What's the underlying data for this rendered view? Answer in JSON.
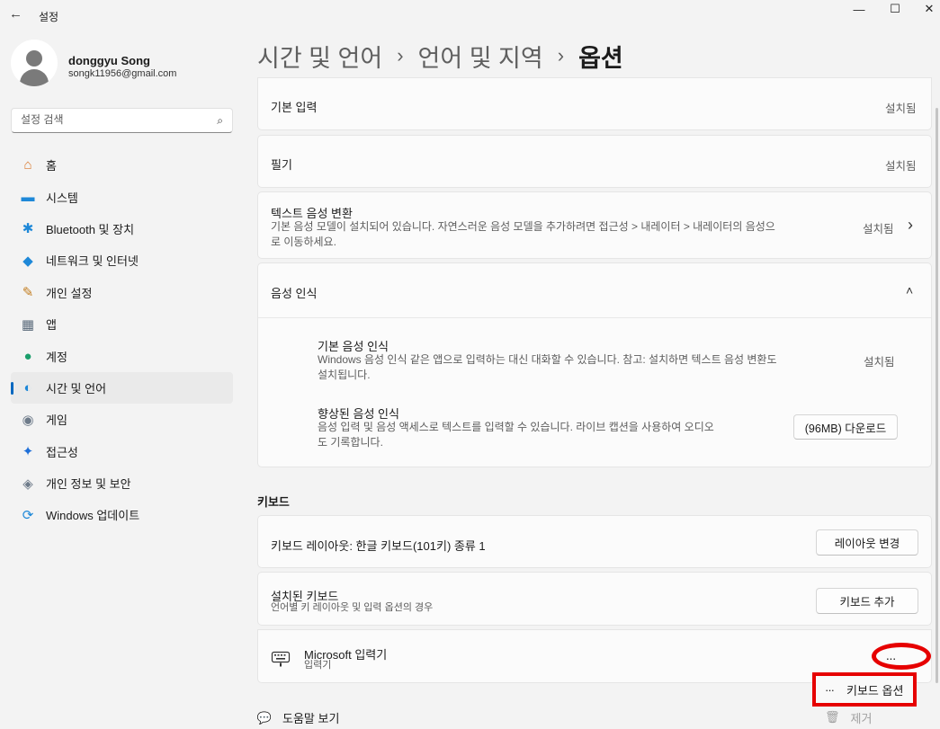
{
  "window": {
    "title": "설정",
    "back": "←",
    "minimize": "—",
    "maximize": "☐",
    "close": "✕"
  },
  "user": {
    "name": "donggyu Song",
    "email": "songk11956@gmail.com"
  },
  "search": {
    "placeholder": "설정 검색",
    "icon": "search-icon"
  },
  "sidebar": {
    "items": [
      {
        "label": "홈",
        "icon": "home-icon",
        "glyph": "⌂",
        "color": "#d9772b"
      },
      {
        "label": "시스템",
        "icon": "system-icon",
        "glyph": "▬",
        "color": "#1e88d8"
      },
      {
        "label": "Bluetooth 및 장치",
        "icon": "bluetooth-icon",
        "glyph": "✱",
        "color": "#1e88d8"
      },
      {
        "label": "네트워크 및 인터넷",
        "icon": "wifi-icon",
        "glyph": "◆",
        "color": "#1e88d8"
      },
      {
        "label": "개인 설정",
        "icon": "brush-icon",
        "glyph": "✎",
        "color": "#c27c1e"
      },
      {
        "label": "앱",
        "icon": "apps-icon",
        "glyph": "▦",
        "color": "#5b6b7b"
      },
      {
        "label": "계정",
        "icon": "account-icon",
        "glyph": "●",
        "color": "#1a9e6b"
      },
      {
        "label": "시간 및 언어",
        "icon": "globe-clock-icon",
        "glyph": "◐",
        "color": "#1e88d8",
        "active": true
      },
      {
        "label": "게임",
        "icon": "gamepad-icon",
        "glyph": "◉",
        "color": "#6e7b8a"
      },
      {
        "label": "접근성",
        "icon": "accessibility-icon",
        "glyph": "✦",
        "color": "#1e6fd8"
      },
      {
        "label": "개인 정보 및 보안",
        "icon": "shield-icon",
        "glyph": "◈",
        "color": "#6e7b8a"
      },
      {
        "label": "Windows 업데이트",
        "icon": "update-icon",
        "glyph": "⟳",
        "color": "#1e88d8"
      }
    ]
  },
  "breadcrumb": {
    "part1": "시간 및 언어",
    "part2": "언어 및 지역",
    "current": "옵션",
    "sep": "›"
  },
  "cards": {
    "basic_input": {
      "title": "기본 입력",
      "status": "설치됨"
    },
    "handwriting": {
      "title": "필기",
      "status": "설치됨"
    },
    "tts": {
      "title": "텍스트 음성 변환",
      "desc_line1": "기본 음성 모델이 설치되어 있습니다. 자연스러운 음성 모델을 추가하려면 접근성 > 내레이터 > 내레이터의 음성으",
      "desc_line2": "로 이동하세요.",
      "status": "설치됨",
      "chevron": "›"
    },
    "speech": {
      "title": "음성 인식",
      "chevron": "˄",
      "basic": {
        "title": "기본 음성 인식",
        "desc_line1": "Windows 음성 인식 같은 앱으로 입력하는 대신 대화할 수 있습니다. 참고: 설치하면 텍스트 음성 변환도",
        "desc_line2": "설치됩니다.",
        "status": "설치됨"
      },
      "enhanced": {
        "title": "향상된 음성 인식",
        "desc_line1": "음성 입력 및 음성 액세스로 텍스트를 입력할 수 있습니다. 라이브 캡션을 사용하여 오디오",
        "desc_line2": "도 기록합니다.",
        "button": "(96MB) 다운로드"
      }
    }
  },
  "keyboard": {
    "section_title": "키보드",
    "layout": {
      "title": "키보드 레이아웃: 한글 키보드(101키) 종류 1",
      "button": "레이아웃 변경"
    },
    "installed": {
      "title": "설치된 키보드",
      "desc": "언어별 키 레이아웃 및 입력 옵션의 경우",
      "button": "키보드 추가"
    },
    "ime": {
      "title": "Microsoft 입력기",
      "subtitle": "입력기",
      "more": "···"
    }
  },
  "context_menu": {
    "options_label": "키보드 옵션",
    "options_dots": "···",
    "remove_label": "제거",
    "remove_icon": "trash-icon"
  },
  "help": {
    "label": "도움말 보기"
  },
  "annotation_color": "#e60000",
  "accent_color": "#0067c0"
}
